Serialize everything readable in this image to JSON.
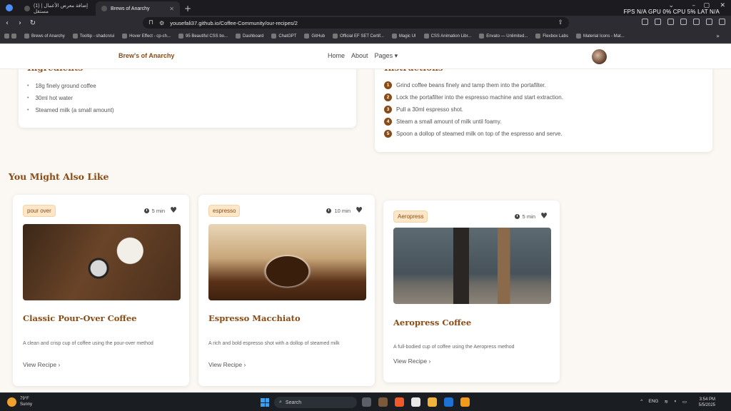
{
  "browser": {
    "tabs": [
      {
        "label": "(1) إضافة معرض الأعمال | مستقل"
      },
      {
        "label": "Brews of Anarchy"
      }
    ],
    "new_tab": "+",
    "perf": "FPS N/A GPU 0% CPU 5% LAT N/A",
    "url": "yousefali37.github.io/Coffee-Community/our-recipes/2",
    "bookmarks": [
      "Brews of Anarchy",
      "Tooltip - shadcn/ui",
      "Hover Effect - cp-ch...",
      "95 Beautiful CSS bo...",
      "Dashboard",
      "ChatGPT",
      "GitHub",
      "Official EF SET Certif...",
      "Magic UI",
      "CSS Animation Libr...",
      "Envato — Unlimited...",
      "Flexbox Labs",
      "Material Icons - Mat..."
    ]
  },
  "site": {
    "brand": "Brew's of Anarchy",
    "nav": [
      "Home",
      "About",
      "Pages ▾"
    ]
  },
  "recipe": {
    "ingredients_title": "Ingredients",
    "ingredients": [
      "18g finely ground coffee",
      "30ml hot water",
      "Steamed milk (a small amount)"
    ],
    "instructions_title": "Instructions",
    "instructions": [
      "Grind coffee beans finely and tamp them into the portafilter.",
      "Lock the portafilter into the espresso machine and start extraction.",
      "Pull a 30ml espresso shot.",
      "Steam a small amount of milk until foamy.",
      "Spoon a dollop of steamed milk on top of the espresso and serve."
    ]
  },
  "related": {
    "title": "You Might Also Like",
    "cards": [
      {
        "tag": "pour over",
        "time": "5 min",
        "title": "Classic Pour-Over Coffee",
        "desc": "A clean and crisp cup of coffee using the pour-over method",
        "link": "View Recipe ›"
      },
      {
        "tag": "espresso",
        "time": "10 min",
        "title": "Espresso Macchiato",
        "desc": "A rich and bold espresso shot with a dollop of steamed milk",
        "link": "View Recipe ›"
      },
      {
        "tag": "Aeropress",
        "time": "5 min",
        "title": "Aeropress Coffee",
        "desc": "A full-bodied cup of coffee using the Aeropress method",
        "link": "View Recipe ›"
      }
    ]
  },
  "taskbar": {
    "temp": "79°F",
    "weather": "Sunny",
    "search": "Search",
    "lang": "ENG",
    "time": "3:54 PM",
    "date": "5/5/2025"
  }
}
